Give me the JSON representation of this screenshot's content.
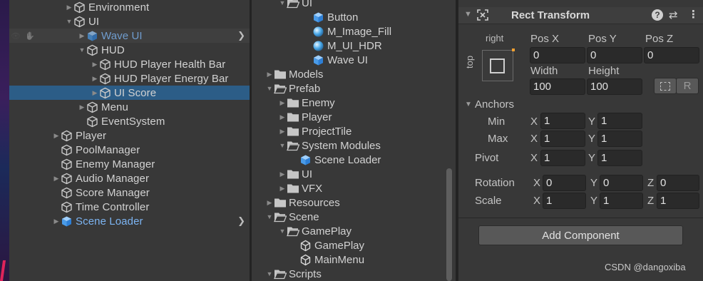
{
  "hierarchy": {
    "rows": [
      {
        "label": "Environment",
        "indent": 1,
        "arrow": "right",
        "icon": "gameobject-icon"
      },
      {
        "label": "UI",
        "indent": 1,
        "arrow": "down",
        "icon": "gameobject-icon"
      },
      {
        "label": "Wave UI",
        "indent": 2,
        "arrow": "right",
        "icon": "prefab-icon",
        "style": "dim",
        "hover": true,
        "chevron": true
      },
      {
        "label": "HUD",
        "indent": 2,
        "arrow": "down",
        "icon": "gameobject-icon"
      },
      {
        "label": "HUD Player Health Bar",
        "indent": 3,
        "arrow": "right",
        "icon": "gameobject-icon"
      },
      {
        "label": "HUD Player Energy Bar",
        "indent": 3,
        "arrow": "right",
        "icon": "gameobject-icon"
      },
      {
        "label": "UI Score",
        "indent": 3,
        "arrow": "right",
        "icon": "gameobject-icon",
        "selected": true
      },
      {
        "label": "Menu",
        "indent": 2,
        "arrow": "right",
        "icon": "gameobject-icon"
      },
      {
        "label": "EventSystem",
        "indent": 2,
        "arrow": "none",
        "icon": "gameobject-icon"
      },
      {
        "label": "Player",
        "indent": 0,
        "arrow": "right",
        "icon": "gameobject-icon"
      },
      {
        "label": "PoolManager",
        "indent": 0,
        "arrow": "none",
        "icon": "gameobject-icon"
      },
      {
        "label": "Enemy Manager",
        "indent": 0,
        "arrow": "none",
        "icon": "gameobject-icon"
      },
      {
        "label": "Audio Manager",
        "indent": 0,
        "arrow": "right",
        "icon": "gameobject-icon"
      },
      {
        "label": "Score Manager",
        "indent": 0,
        "arrow": "none",
        "icon": "gameobject-icon"
      },
      {
        "label": "Time Controller",
        "indent": 0,
        "arrow": "none",
        "icon": "gameobject-icon"
      },
      {
        "label": "Scene Loader",
        "indent": 0,
        "arrow": "right",
        "icon": "prefab-icon",
        "style": "blue",
        "chevron": true
      }
    ]
  },
  "project": {
    "rows": [
      {
        "label": "UI",
        "indent": 1,
        "arrow": "down",
        "icon": "open-folder-icon"
      },
      {
        "label": "Button",
        "indent": 3,
        "arrow": "none",
        "icon": "prefab-icon"
      },
      {
        "label": "M_Image_Fill",
        "indent": 3,
        "arrow": "none",
        "icon": "material-icon"
      },
      {
        "label": "M_UI_HDR",
        "indent": 3,
        "arrow": "none",
        "icon": "material-icon"
      },
      {
        "label": "Wave UI",
        "indent": 3,
        "arrow": "none",
        "icon": "prefab-icon"
      },
      {
        "label": "Models",
        "indent": 0,
        "arrow": "right",
        "icon": "folder-icon"
      },
      {
        "label": "Prefab",
        "indent": 0,
        "arrow": "down",
        "icon": "open-folder-icon"
      },
      {
        "label": "Enemy",
        "indent": 1,
        "arrow": "right",
        "icon": "folder-icon"
      },
      {
        "label": "Player",
        "indent": 1,
        "arrow": "right",
        "icon": "folder-icon"
      },
      {
        "label": "ProjectTile",
        "indent": 1,
        "arrow": "right",
        "icon": "folder-icon"
      },
      {
        "label": "System Modules",
        "indent": 1,
        "arrow": "down",
        "icon": "open-folder-icon"
      },
      {
        "label": "Scene Loader",
        "indent": 2,
        "arrow": "none",
        "icon": "prefab-icon"
      },
      {
        "label": "UI",
        "indent": 1,
        "arrow": "right",
        "icon": "folder-icon"
      },
      {
        "label": "VFX",
        "indent": 1,
        "arrow": "right",
        "icon": "folder-icon"
      },
      {
        "label": "Resources",
        "indent": 0,
        "arrow": "right",
        "icon": "folder-icon"
      },
      {
        "label": "Scene",
        "indent": 0,
        "arrow": "down",
        "icon": "open-folder-icon"
      },
      {
        "label": "GamePlay",
        "indent": 1,
        "arrow": "down",
        "icon": "open-folder-icon"
      },
      {
        "label": "GamePlay",
        "indent": 2,
        "arrow": "none",
        "icon": "unity-scene-icon"
      },
      {
        "label": "MainMenu",
        "indent": 2,
        "arrow": "none",
        "icon": "unity-scene-icon"
      },
      {
        "label": "Scripts",
        "indent": 0,
        "arrow": "down",
        "icon": "open-folder-icon"
      }
    ]
  },
  "inspector": {
    "component_title": "Rect Transform",
    "anchor_preset_horizontal": "right",
    "anchor_preset_vertical": "top",
    "pos_x_label": "Pos X",
    "pos_y_label": "Pos Y",
    "pos_z_label": "Pos Z",
    "pos_x": "0",
    "pos_y": "0",
    "pos_z": "0",
    "width_label": "Width",
    "height_label": "Height",
    "width": "100",
    "height": "100",
    "blueprint_button": "R",
    "anchors_label": "Anchors",
    "min_label": "Min",
    "max_label": "Max",
    "pivot_label": "Pivot",
    "rotation_label": "Rotation",
    "scale_label": "Scale",
    "x_label": "X",
    "y_label": "Y",
    "z_label": "Z",
    "anchor_min_x": "1",
    "anchor_min_y": "1",
    "anchor_max_x": "1",
    "anchor_max_y": "1",
    "pivot_x": "1",
    "pivot_y": "1",
    "rotation_x": "0",
    "rotation_y": "0",
    "rotation_z": "0",
    "scale_x": "1",
    "scale_y": "1",
    "scale_z": "1",
    "add_component": "Add Component"
  },
  "watermark": "CSDN @dangoxiba",
  "colors": {
    "panel_bg": "#383838",
    "selection": "#2c5d87",
    "prefab_blue": "#7cb4f2",
    "field_bg": "#2a2a2a"
  }
}
